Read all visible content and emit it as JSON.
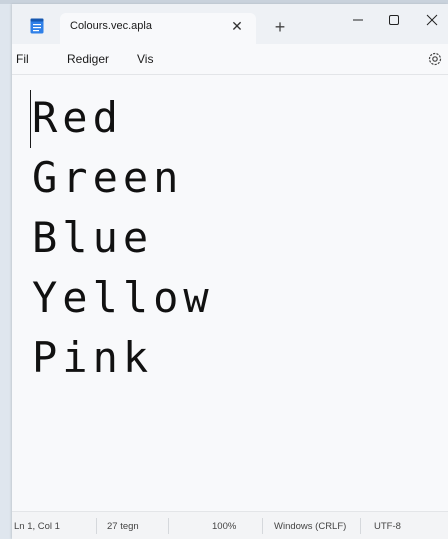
{
  "tab": {
    "title": "Colours.vec.apla"
  },
  "menu": {
    "items": [
      "Fil",
      "Rediger",
      "Vis"
    ]
  },
  "editor": {
    "lines": [
      "Red",
      "Green",
      "Blue",
      "Yellow",
      "Pink"
    ]
  },
  "status": {
    "position": "Ln 1, Col 1",
    "chars": "27 tegn",
    "zoom": "100%",
    "line_ending": "Windows (CRLF)",
    "encoding": "UTF-8"
  },
  "icons": {
    "app": "notepad-icon",
    "tab_close": "close-icon",
    "new_tab": "plus-icon",
    "minimize": "minimize-icon",
    "maximize": "maximize-icon",
    "close": "close-icon",
    "settings": "gear-icon"
  },
  "colors": {
    "app_icon": "#1e6fd9",
    "background": "#f8f9fb"
  }
}
